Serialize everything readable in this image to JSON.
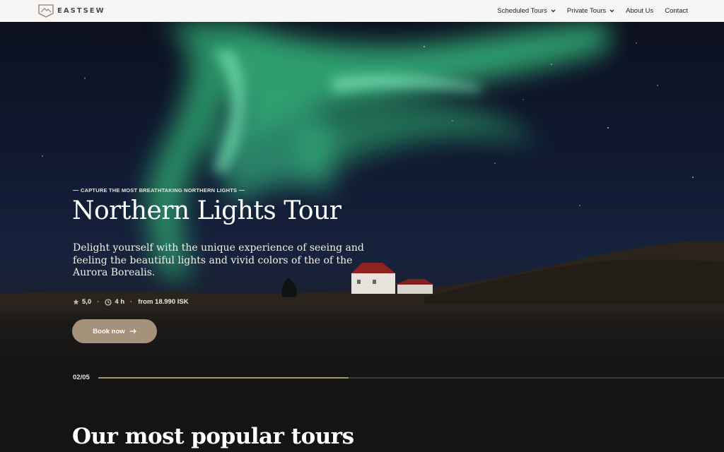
{
  "brand": {
    "name": "EASTSEW",
    "logo_icon": "mountain-logo-icon"
  },
  "nav": {
    "items": [
      {
        "label": "Scheduled Tours",
        "has_dropdown": true
      },
      {
        "label": "Private Tours",
        "has_dropdown": true
      },
      {
        "label": "About Us",
        "has_dropdown": false
      },
      {
        "label": "Contact",
        "has_dropdown": false
      }
    ]
  },
  "hero": {
    "eyebrow": "CAPTURE THE MOST BREATHTAKING NORTHERN LIGHTS",
    "title": "Northern Lights Tour",
    "description": "Delight yourself with the unique experience of seeing and feeling the beautiful lights and vivid colors of the of the Aurora Borealis.",
    "rating": "5,0",
    "duration": "4 h",
    "price": "from 18.990 ISK",
    "cta_label": "Book now",
    "slide_counter": "02/05",
    "slide_progress": 0.4
  },
  "popular": {
    "title": "Our most popular tours"
  },
  "colors": {
    "accent": "#a4927a",
    "nav_bg": "#f7f6f4",
    "page_bg": "#141414",
    "aurora": "#3fcf92"
  }
}
